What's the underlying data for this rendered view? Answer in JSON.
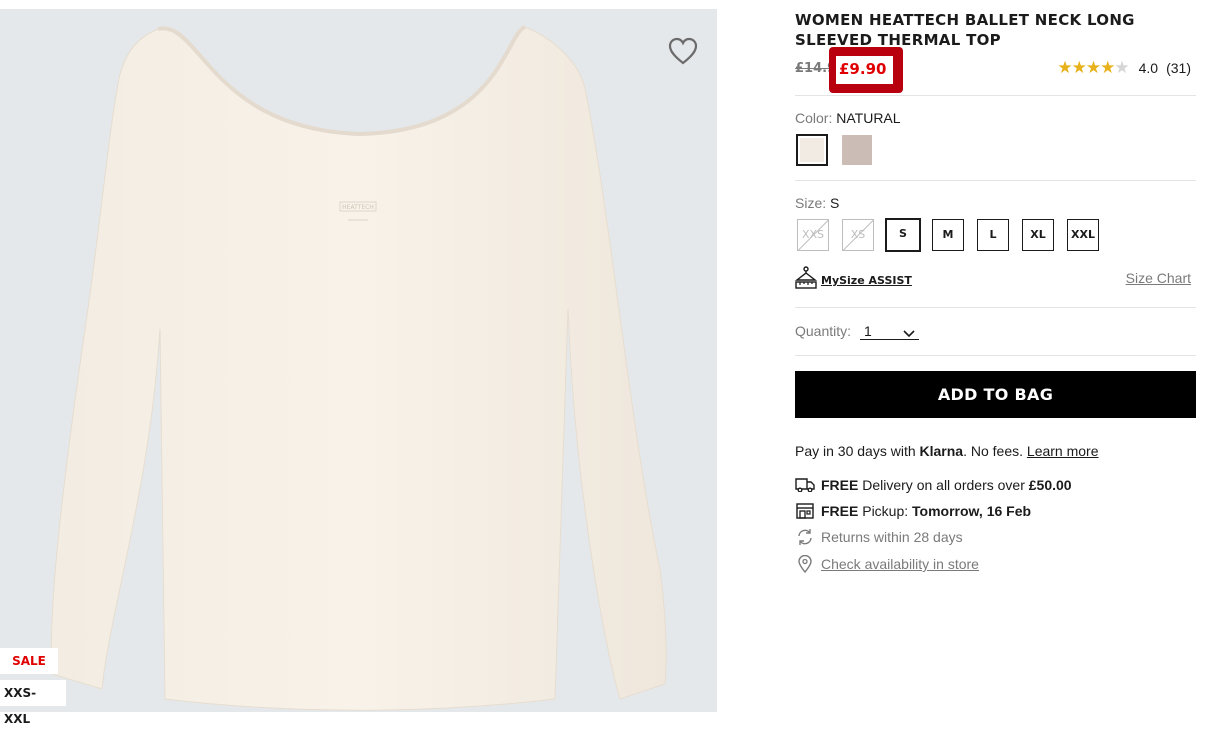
{
  "image": {
    "flags": {
      "sale": "SALE",
      "size_range": "XXS-XXL"
    },
    "shirt_print": "HEATTECH",
    "icons": {
      "wishlist": "heart-icon"
    }
  },
  "product": {
    "title": "WOMEN HEATTECH BALLET NECK LONG SLEEVED THERMAL TOP",
    "original_price": "£14.90",
    "sale_price": "£9.90",
    "rating_value": "4.0",
    "rating_count": "(31)",
    "rating_stars": 4
  },
  "color": {
    "label": "Color:",
    "selected": "NATURAL",
    "swatches": [
      {
        "color": "#f2ebe3"
      },
      {
        "color": "#cbbcb6"
      }
    ]
  },
  "size": {
    "label": "Size:",
    "selected": "S",
    "options": [
      "XXS",
      "XS",
      "S",
      "M",
      "L",
      "XL",
      "XXL"
    ],
    "mysize_assist": "MySize ASSIST",
    "size_chart": "Size Chart"
  },
  "quantity": {
    "label": "Quantity:",
    "value": "1"
  },
  "add_to_bag": "ADD TO BAG",
  "klarna": {
    "prefix": "Pay in 30 days with",
    "brand": "Klarna",
    "suffix": ". No fees.",
    "link": "Learn more"
  },
  "delivery": {
    "free": "FREE",
    "text": "Delivery on all orders over",
    "threshold": "£50.00"
  },
  "pickup": {
    "free": "FREE",
    "text": "Pickup:",
    "when": "Tomorrow, 16 Feb"
  },
  "returns": "Returns within 28 days",
  "store_check": "Check availability in store",
  "colors": {
    "sale_red": "#e00000",
    "highlight_box": "#b8000f",
    "star_gold": "#e8b21c",
    "image_bg": "#e5e8ea"
  }
}
